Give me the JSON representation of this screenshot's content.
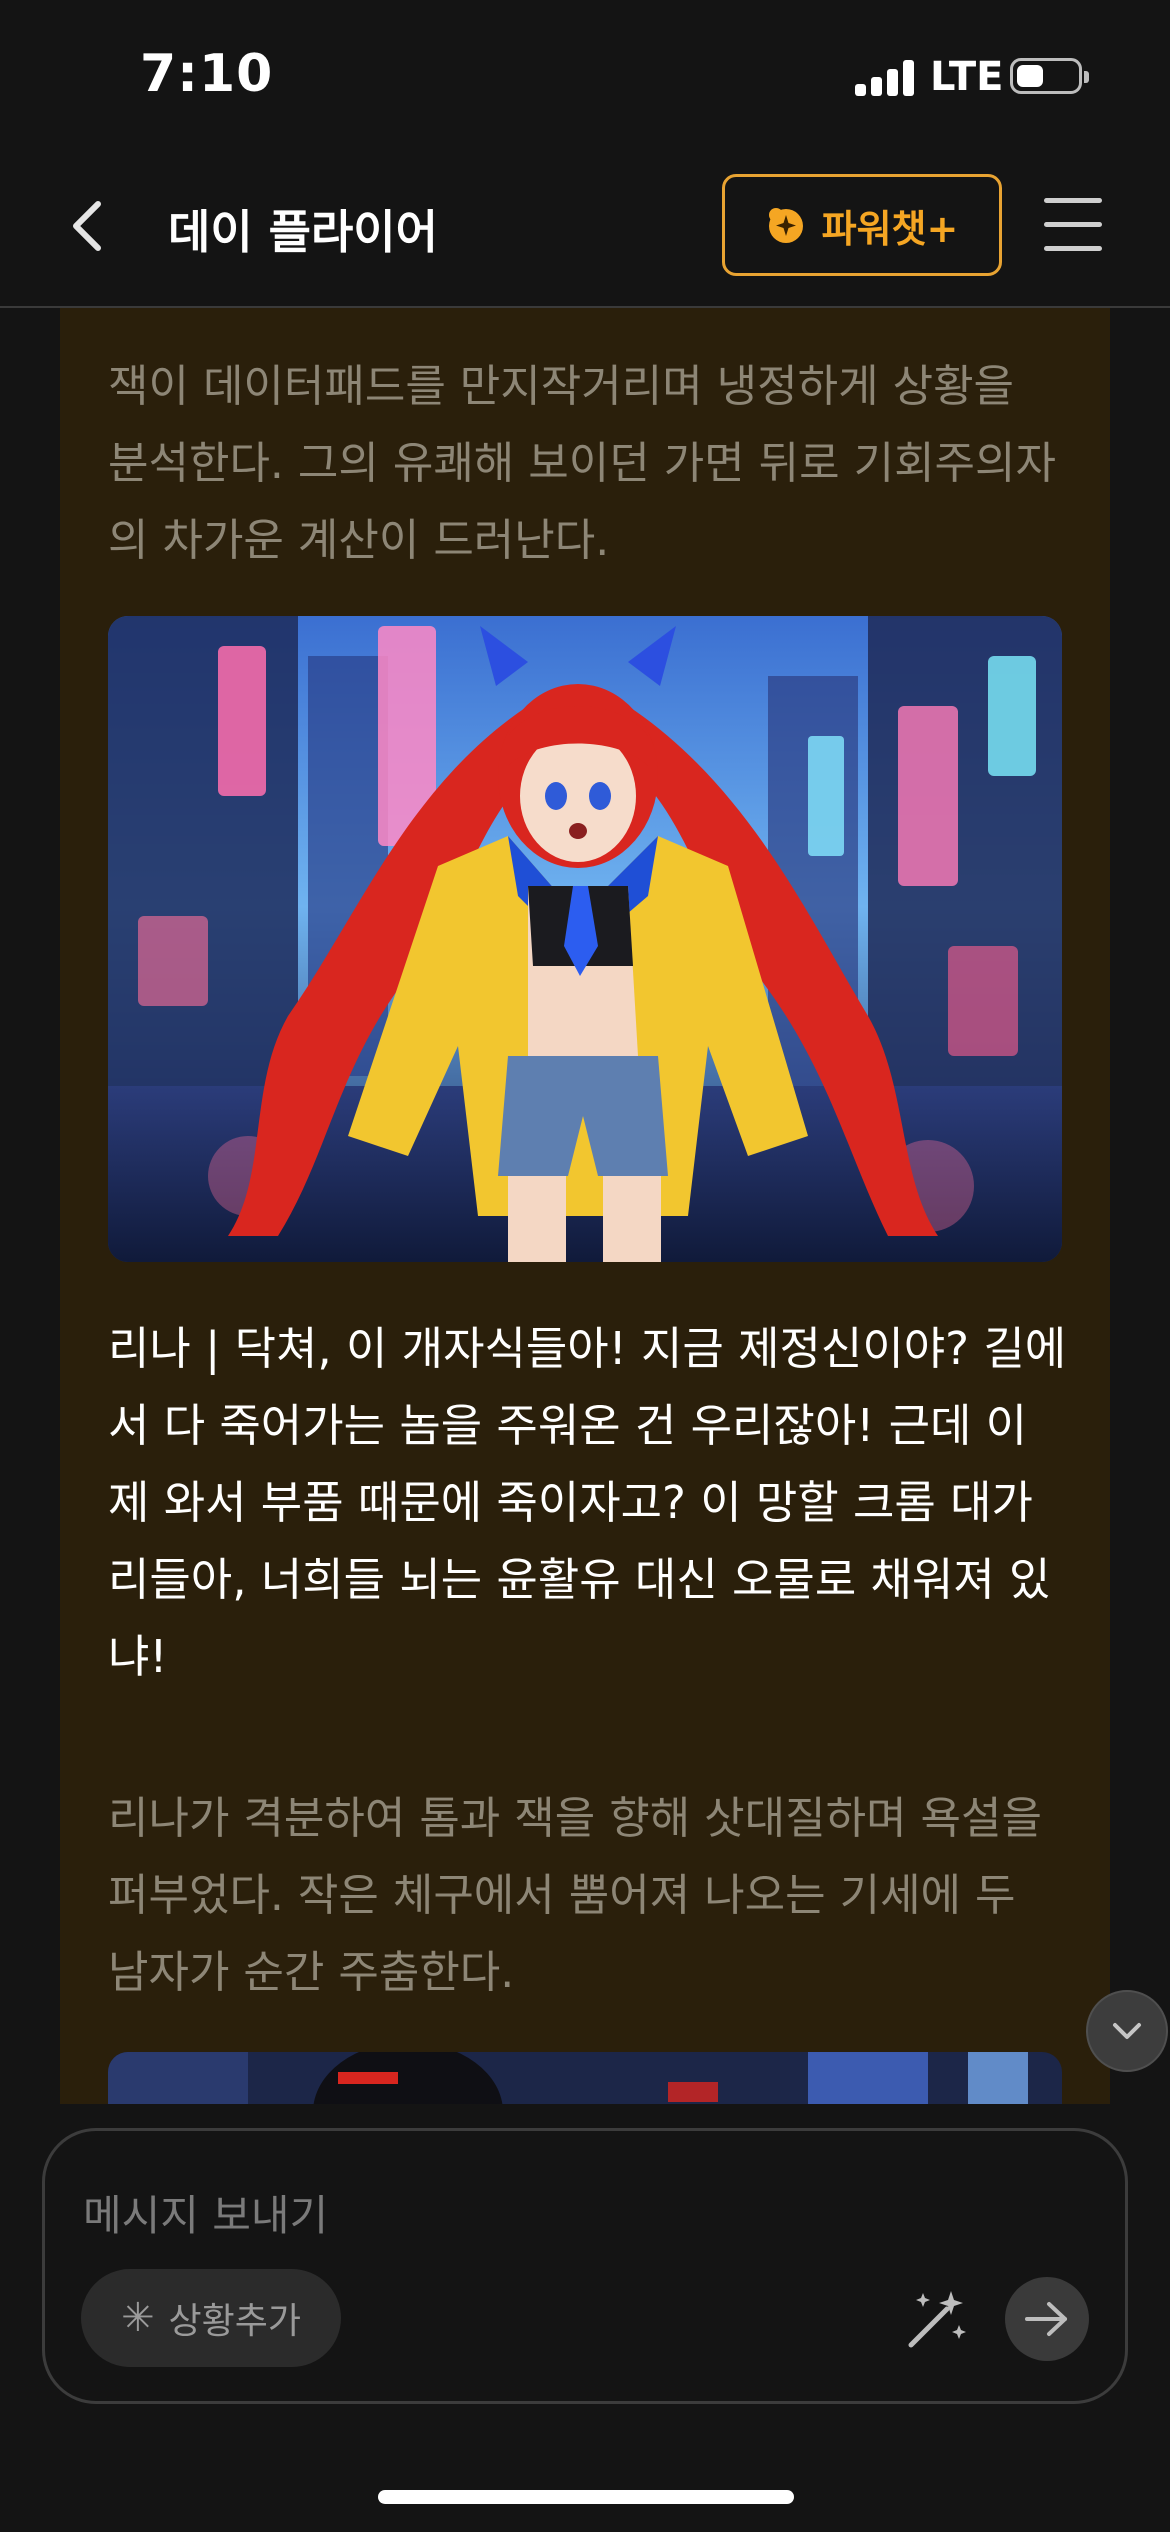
{
  "status_bar": {
    "time": "7:10",
    "network": "LTE",
    "battery_level": 0.45
  },
  "header": {
    "title": "데이 플라이어",
    "power_chat_label": "파워챗+",
    "accent_color": "#f5a623"
  },
  "messages": {
    "narration_1": "잭이 데이터패드를 만지작거리며 냉정하게 상황을 분석한다. 그의 유쾌해 보이던 가면 뒤로 기회주의자의 차가운 계산이 드러난다.",
    "image_1_icon": "anime-girl-neon-city-illustration",
    "dialogue_1": "리나 | 닥쳐, 이 개자식들아! 지금 제정신이야? 길에서 다 죽어가는 놈을 주워온 건 우리잖아! 근데 이제 와서 부품 때문에 죽이자고? 이 망할 크롬 대가리들아, 너희들 뇌는 윤활유 대신 오물로 채워져 있냐!",
    "narration_2": "리나가 격분하여 톰과 잭을 향해 삿대질하며 욕설을 퍼부었다. 작은 체구에서 뿜어져 나오는 기세에 두 남자가 순간 주춤한다.",
    "image_2_icon": "neon-city-character-illustration"
  },
  "composer": {
    "placeholder": "메시지 보내기",
    "situation_label": "상황추가",
    "situation_icon": "asterisk-icon",
    "magic_icon": "magic-wand-icon",
    "send_icon": "arrow-right-icon"
  }
}
